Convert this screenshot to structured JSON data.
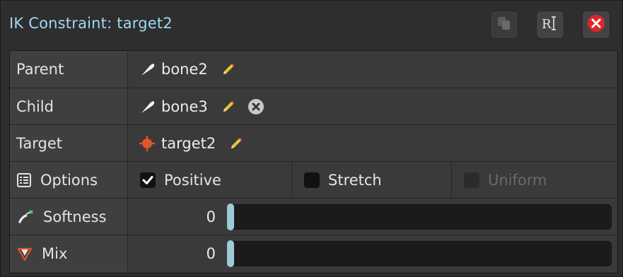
{
  "window": {
    "title": "IK Constraint: target2"
  },
  "rows": {
    "parent": {
      "label": "Parent",
      "value": "bone2"
    },
    "child": {
      "label": "Child",
      "value": "bone3"
    },
    "target": {
      "label": "Target",
      "value": "target2"
    },
    "options": {
      "label": "Options",
      "items": [
        {
          "label": "Positive",
          "checked": true,
          "enabled": true
        },
        {
          "label": "Stretch",
          "checked": false,
          "enabled": true
        },
        {
          "label": "Uniform",
          "checked": false,
          "enabled": false
        }
      ]
    },
    "softness": {
      "label": "Softness",
      "value": "0",
      "slider_fraction": 0
    },
    "mix": {
      "label": "Mix",
      "value": "0",
      "slider_fraction": 0
    }
  },
  "icons": {
    "bone": "bone-icon",
    "edit": "pencil-icon",
    "clear": "clear-icon",
    "target": "target-icon",
    "options": "options-list-icon",
    "softness": "softness-icon",
    "mix": "mix-icon",
    "copy": "copy-icon",
    "rename": "rename-icon",
    "close": "close-icon"
  },
  "colors": {
    "title": "#9fd8f0",
    "close_button": "#e0262a",
    "target_icon": "#e0552a",
    "pencil": "#e8c23a",
    "slider_knob": "#9fc9d4"
  }
}
